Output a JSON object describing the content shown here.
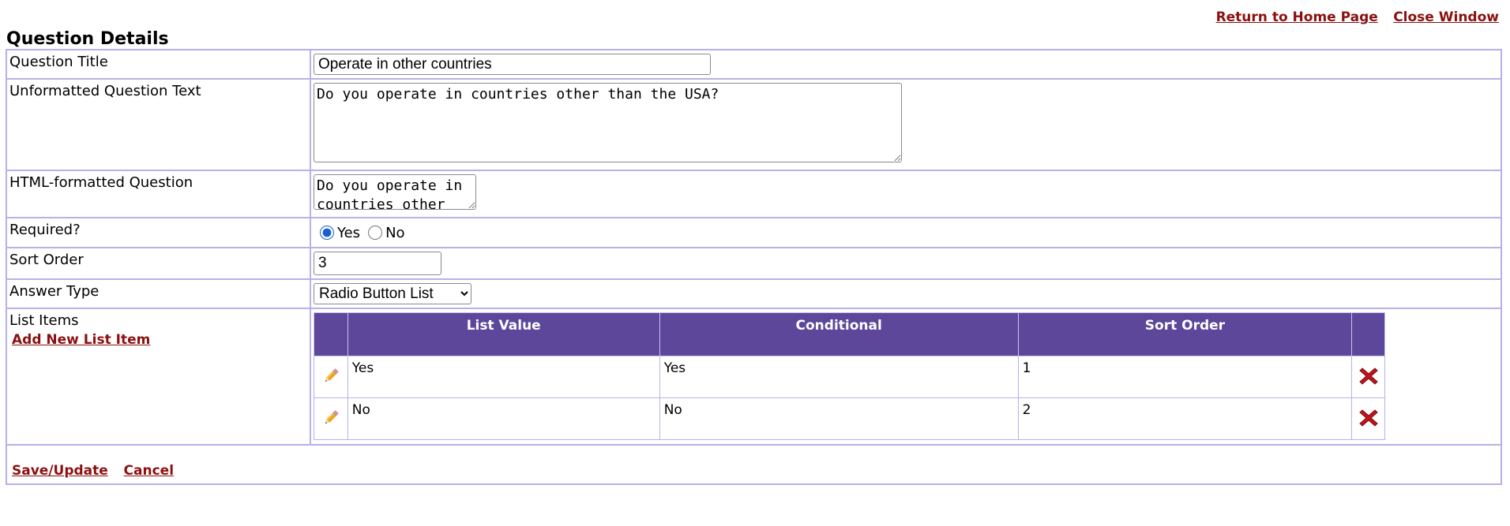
{
  "header": {
    "return_home": "Return to Home Page",
    "close_window": "Close Window"
  },
  "page_title": "Question Details",
  "fields": {
    "question_title": {
      "label": "Question Title",
      "value": "Operate in other countries"
    },
    "unformatted_text": {
      "label": "Unformatted Question Text",
      "value": "Do you operate in countries other than the USA?"
    },
    "html_question": {
      "label": "HTML-formatted Question",
      "value": "Do you operate in countries other than the USA?"
    },
    "required": {
      "label": "Required?",
      "options": [
        "Yes",
        "No"
      ],
      "selected": "Yes"
    },
    "sort_order": {
      "label": "Sort Order",
      "value": "3"
    },
    "answer_type": {
      "label": "Answer Type",
      "value": "Radio Button List"
    }
  },
  "list_items": {
    "label": "List Items",
    "add_link": "Add New List Item",
    "columns": [
      "List Value",
      "Conditional",
      "Sort Order"
    ],
    "rows": [
      {
        "value": "Yes",
        "conditional": "Yes",
        "sort": "1"
      },
      {
        "value": "No",
        "conditional": "No",
        "sort": "2"
      }
    ],
    "edit_icon": "pencil-icon",
    "delete_icon": "delete-x-icon",
    "header_color": "#5c479b",
    "delete_color": "#c0141b"
  },
  "actions": {
    "save": "Save/Update",
    "cancel": "Cancel"
  }
}
